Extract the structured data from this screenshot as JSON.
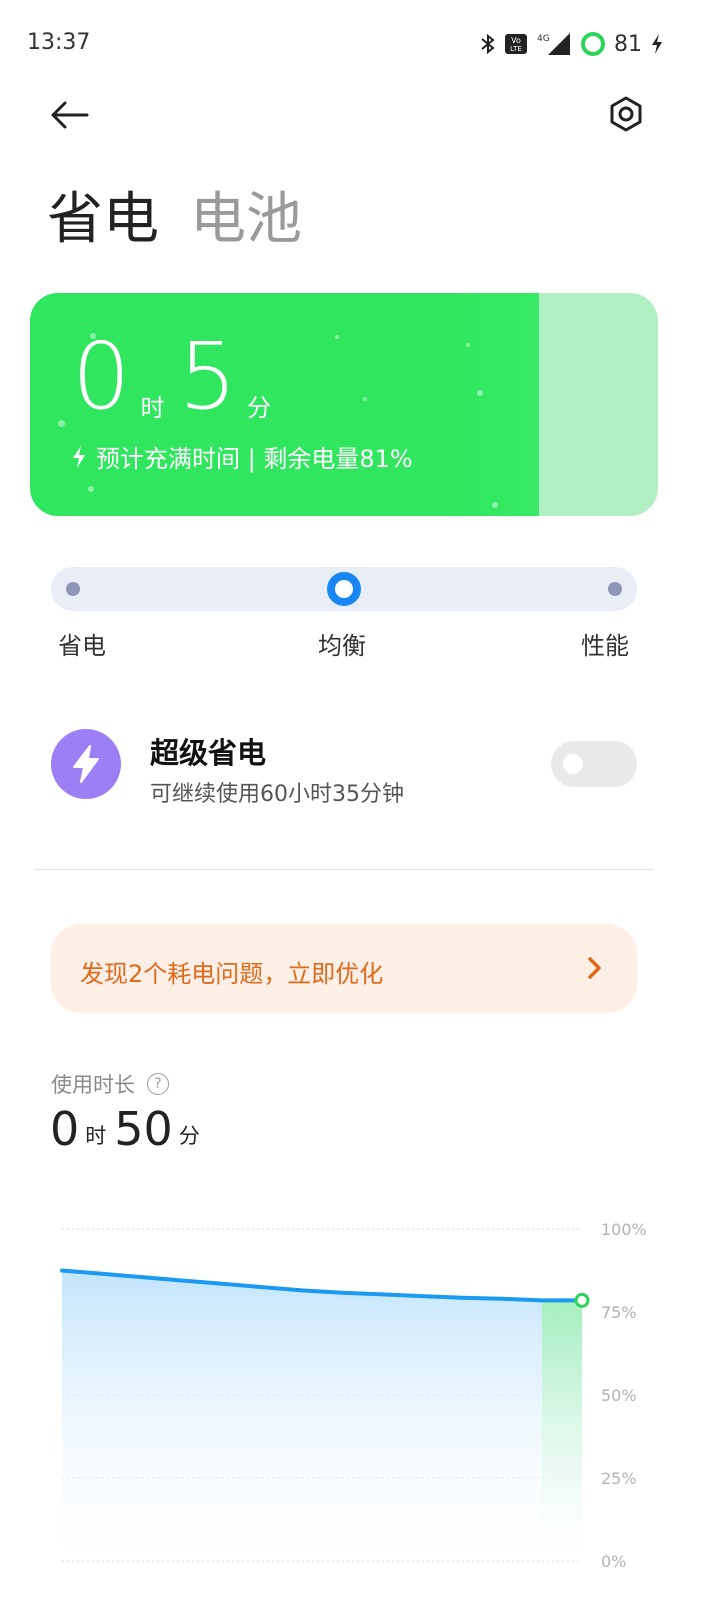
{
  "status_bar": {
    "time": "13:37",
    "battery": "81",
    "icons": [
      "bluetooth-icon",
      "volte-icon",
      "4g-signal-icon",
      "battery-ring-icon",
      "charging-bolt-icon"
    ]
  },
  "header": {
    "tabs": [
      {
        "label": "省电",
        "active": true
      },
      {
        "label": "电池",
        "active": false
      }
    ],
    "icons": [
      "back-arrow-icon",
      "settings-gear-icon"
    ]
  },
  "battery_card": {
    "hours": "0",
    "hours_unit": "时",
    "minutes": "5",
    "minutes_unit": "分",
    "subtitle": "预计充满时间 | 剩余电量81%",
    "charge_level": 0.81,
    "colors": {
      "fill": "#2fe65e",
      "remaining": "#b2f0c3"
    }
  },
  "mode_slider": {
    "options": [
      "省电",
      "均衡",
      "性能"
    ],
    "selected": "均衡",
    "accent": "#1a86f5"
  },
  "super_saver": {
    "title": "超级省电",
    "subtitle": "可继续使用60小时35分钟",
    "enabled": false,
    "icon_color": "#9c7ef5"
  },
  "issues_banner": {
    "text": "发现2个耗电问题，立即优化",
    "color": "#e06a1b"
  },
  "usage": {
    "label": "使用时长",
    "hours": "0",
    "hours_unit": "时",
    "minutes": "50",
    "minutes_unit": "分"
  },
  "chart_data": {
    "type": "area",
    "y_ticks": [
      "100%",
      "75%",
      "50%",
      "25%",
      "0%"
    ],
    "ylim": [
      0,
      100
    ],
    "series": [
      {
        "values": [
          87.5,
          86.5,
          85.5,
          84.5,
          83.5,
          82.5,
          81.5,
          80.8,
          80.3,
          79.8,
          79.3,
          79,
          78.5,
          78.5
        ]
      }
    ],
    "current_value": 78.5,
    "grid": true,
    "colors": {
      "line": "#1a9af0",
      "area_top": "#bfe3fb",
      "highlight": "#2ed35c"
    }
  }
}
